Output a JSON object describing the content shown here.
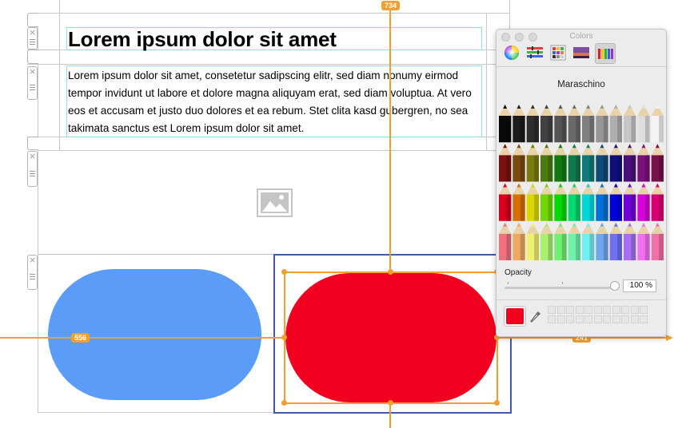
{
  "canvas": {
    "title": "Lorem ipsum dolor sit amet",
    "paragraph": "Lorem ipsum dolor sit amet, consetetur sadipscing elitr, sed diam nonumy eirmod tempor invidunt ut labore et dolore magna aliquyam erat, sed diam voluptua. At vero eos et accusam et justo duo dolores et ea rebum. Stet clita kasd gubergren, no sea takimata sanctus est Lorem ipsum dolor sit amet.",
    "image_placeholder_icon": "image-icon",
    "left_shape_color": "#5a9cf8",
    "right_shape_color": "#f2001f"
  },
  "measurements": {
    "top_value": "734",
    "left_value": "556",
    "right_value": "241"
  },
  "colors_panel": {
    "title": "Colors",
    "tabs": [
      "color-wheel-icon",
      "color-sliders-icon",
      "color-palettes-icon",
      "image-palettes-icon",
      "crayons-icon"
    ],
    "selected_color_name": "Maraschino",
    "opacity_label": "Opacity",
    "opacity_value": "100 %",
    "current_color": "#f2001f",
    "eyedropper_icon": "eyedropper-icon"
  }
}
